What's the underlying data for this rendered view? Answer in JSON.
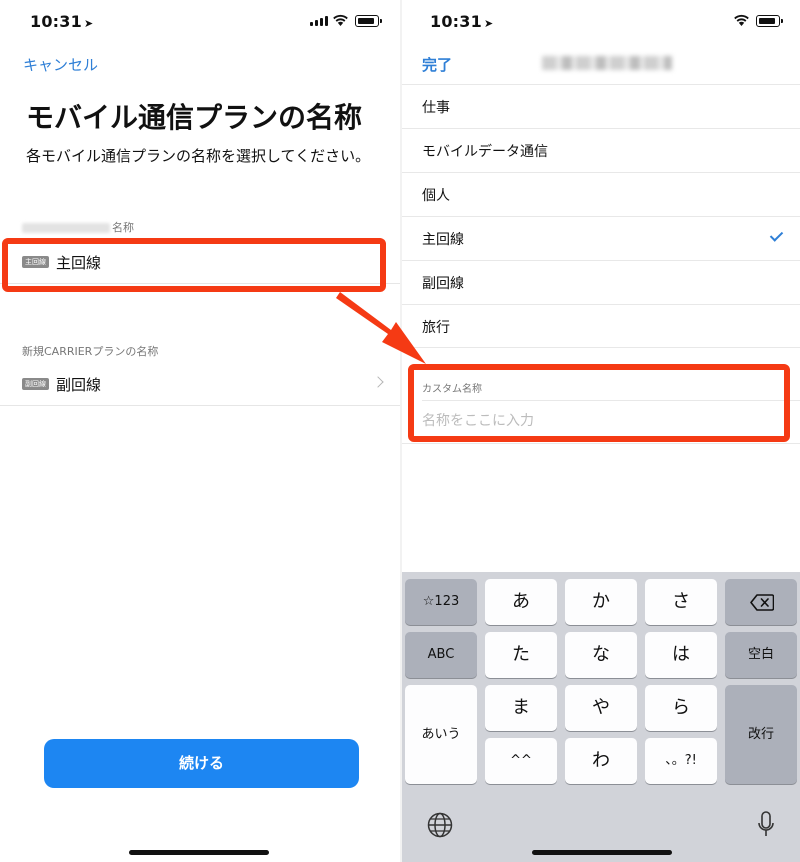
{
  "colors": {
    "accent": "#2f7fd6",
    "button": "#1d86f2",
    "highlight": "#f53a14"
  },
  "left": {
    "status": {
      "time": "10:31"
    },
    "cancel_label": "キャンセル",
    "title": "モバイル通信プランの名称",
    "subtitle": "各モバイル通信プランの名称を選択してください。",
    "section1_suffix": "名称",
    "row1": {
      "badge": "主回線",
      "label": "主回線"
    },
    "section2_header": "新規CARRIERプランの名称",
    "row2": {
      "badge": "副回線",
      "label": "副回線"
    },
    "continue_label": "続ける"
  },
  "right": {
    "status": {
      "time": "10:31"
    },
    "done_label": "完了",
    "options": [
      "仕事",
      "モバイルデータ通信",
      "個人",
      "主回線",
      "副回線",
      "旅行"
    ],
    "selected_option": "主回線",
    "custom_header": "カスタム名称",
    "custom_placeholder": "名称をここに入力",
    "keyboard": {
      "row1": [
        "☆123",
        "あ",
        "か",
        "さ"
      ],
      "row2": [
        "ABC",
        "た",
        "な",
        "は",
        "空白"
      ],
      "row3": [
        "あいう",
        "ま",
        "や",
        "ら",
        "改行"
      ],
      "row4": [
        "^^",
        "わ",
        "、。?!"
      ],
      "icons": [
        "delete-icon",
        "globe-icon",
        "microphone-icon"
      ]
    }
  }
}
